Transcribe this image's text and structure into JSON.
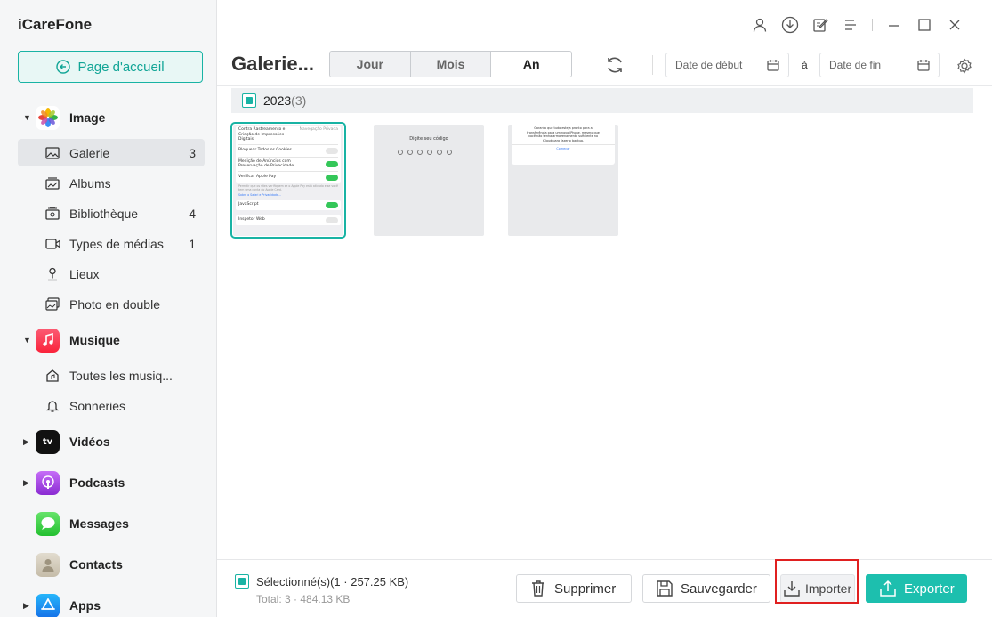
{
  "app": {
    "title": "iCareFone"
  },
  "sidebar": {
    "home_label": "Page d'accueil",
    "categories": [
      {
        "label": "Image",
        "expanded": true,
        "icon": "photos-icon"
      },
      {
        "label": "Musique",
        "expanded": true,
        "icon": "music-icon"
      },
      {
        "label": "Vidéos",
        "expanded": false,
        "icon": "tv-icon"
      },
      {
        "label": "Podcasts",
        "expanded": false,
        "icon": "podcasts-icon"
      },
      {
        "label": "Messages",
        "expanded": false,
        "icon": "messages-icon"
      },
      {
        "label": "Contacts",
        "expanded": false,
        "icon": "contacts-icon"
      },
      {
        "label": "Apps",
        "expanded": false,
        "icon": "appstore-icon"
      }
    ],
    "image_items": [
      {
        "label": "Galerie",
        "count": "3",
        "icon": "image-icon",
        "active": true
      },
      {
        "label": "Albums",
        "count": "",
        "icon": "album-icon"
      },
      {
        "label": "Bibliothèque",
        "count": "4",
        "icon": "library-icon"
      },
      {
        "label": "Types de médias",
        "count": "1",
        "icon": "video-icon"
      },
      {
        "label": "Lieux",
        "count": "",
        "icon": "location-icon"
      },
      {
        "label": "Photo en double",
        "count": "",
        "icon": "duplicate-icon"
      }
    ],
    "music_items": [
      {
        "label": "Toutes les musiq...",
        "icon": "music-home-icon"
      },
      {
        "label": "Sonneries",
        "icon": "bell-icon"
      }
    ]
  },
  "toolbar": {
    "page_title": "Galerie...",
    "tabs": [
      "Jour",
      "Mois",
      "An"
    ],
    "active_tab": "An",
    "start_date_placeholder": "Date de début",
    "date_separator": "à",
    "end_date_placeholder": "Date de fin"
  },
  "gallery": {
    "group_year": "2023",
    "group_count": "(3)",
    "thumb1": {
      "row1a": "Contra Rastreamento e",
      "row1b": "Criação de Impressões",
      "row1c": "Digitais",
      "row1_right": "Navegação Privada",
      "row2": "Bloquear Todos os Cookies",
      "row3a": "Medição de Anúncios com",
      "row3b": "Preservação de Privacidade",
      "row4": "Verificar Apple Pay",
      "note": "Permitir que os sites verifiquem se o Apple Pay está ativado e se você tem uma conta do Apple Card.",
      "link": "Sobre o Safari e Privacidade...",
      "row5": "JavaScript",
      "row6": "Inspetor Web"
    },
    "thumb2": {
      "prompt": "Digite seu código"
    },
    "thumb3": {
      "line1": "Garanta que tudo esteja pronto para a",
      "line2": "transferência para um novo iPhone, mesmo que",
      "line3": "você não tenha armazenamento suficiente no",
      "line4": "iCloud para fazer o backup.",
      "button": "Começar"
    }
  },
  "bottom": {
    "selected_text": "Sélectionné(s)(1 · 257.25 KB)",
    "total_text": "Total: 3 · 484.13 KB",
    "delete_label": "Supprimer",
    "save_label": "Sauvegarder",
    "import_label": "Importer",
    "export_label": "Exporter"
  },
  "colors": {
    "accent": "#19b3a4",
    "highlight": "#e02020"
  }
}
